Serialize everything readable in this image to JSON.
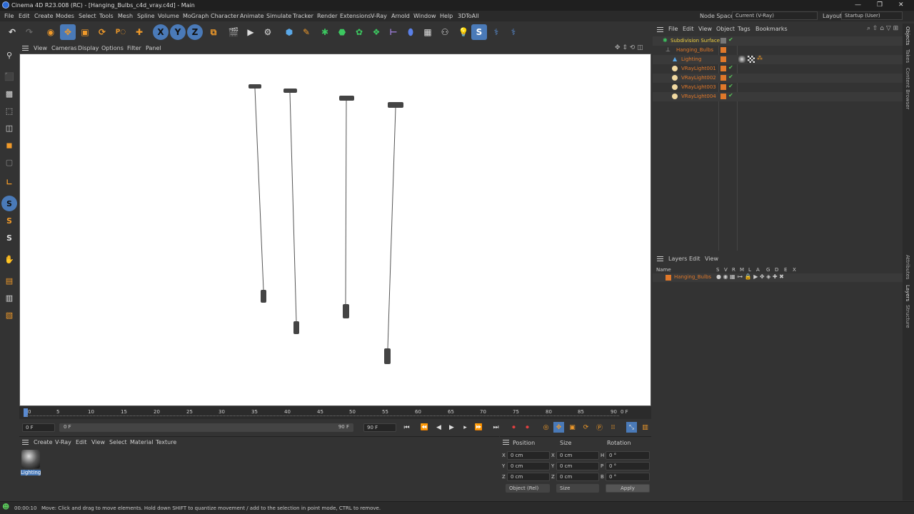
{
  "window": {
    "title": "Cinema 4D R23.008 (RC) - [Hanging_Bulbs_c4d_vray.c4d] - Main",
    "minimize": "—",
    "maximize": "❐",
    "close": "✕"
  },
  "menubar": [
    "File",
    "Edit",
    "Create",
    "Modes",
    "Select",
    "Tools",
    "Mesh",
    "Spline",
    "Volume",
    "MoGraph",
    "Character",
    "Animate",
    "Simulate",
    "Tracker",
    "Render",
    "Extensions",
    "V-Ray",
    "Arnold",
    "Window",
    "Help",
    "3DToAll"
  ],
  "node_space": {
    "label": "Node Space:",
    "value": "Current (V-Ray)"
  },
  "layout": {
    "label": "Layout:",
    "value": "Startup (User)"
  },
  "viewport_menu": [
    "View",
    "Cameras",
    "Display",
    "Options",
    "Filter",
    "Panel"
  ],
  "timeline": {
    "ticks": [
      "0",
      "5",
      "10",
      "15",
      "20",
      "25",
      "30",
      "35",
      "40",
      "45",
      "50",
      "55",
      "60",
      "65",
      "70",
      "75",
      "80",
      "85",
      "90"
    ],
    "current_frame": "0 F",
    "start_field": "0 F",
    "range_start": "0 F",
    "range_end": "90 F",
    "end_field": "90 F"
  },
  "material_menu": [
    "Create",
    "V-Ray",
    "Edit",
    "View",
    "Select",
    "Material",
    "Texture"
  ],
  "material": {
    "name": "Lighting"
  },
  "coords": {
    "headers": [
      "Position",
      "Size",
      "Rotation"
    ],
    "rows": [
      {
        "axis": "X",
        "pos": "0 cm",
        "saxis": "X",
        "size": "0 cm",
        "raxis": "H",
        "rot": "0 °"
      },
      {
        "axis": "Y",
        "pos": "0 cm",
        "saxis": "Y",
        "size": "0 cm",
        "raxis": "P",
        "rot": "0 °"
      },
      {
        "axis": "Z",
        "pos": "0 cm",
        "saxis": "Z",
        "size": "0 cm",
        "raxis": "B",
        "rot": "0 °"
      }
    ],
    "mode": "Object (Rel)",
    "size_mode": "Size",
    "apply": "Apply"
  },
  "status": {
    "time": "00:00:10",
    "message": "Move: Click and drag to move elements. Hold down SHIFT to quantize movement / add to the selection in point mode, CTRL to remove."
  },
  "object_menu": [
    "File",
    "Edit",
    "View",
    "Object",
    "Tags",
    "Bookmarks"
  ],
  "objects": [
    {
      "name": "Subdivision Surface",
      "color": "#f0d040"
    },
    {
      "name": "Hanging_Bulbs",
      "color": "#e0782a"
    },
    {
      "name": "Lighting",
      "color": "#e0782a"
    },
    {
      "name": "VRayLight001",
      "color": "#e0782a"
    },
    {
      "name": "VRayLight002",
      "color": "#e0782a"
    },
    {
      "name": "VRayLight003",
      "color": "#e0782a"
    },
    {
      "name": "VRayLight004",
      "color": "#e0782a"
    }
  ],
  "layer_menu": [
    "Layers",
    "Edit",
    "View"
  ],
  "layer_header": {
    "name": "Name",
    "cols": [
      "S",
      "V",
      "R",
      "M",
      "L",
      "A",
      "G",
      "D",
      "E",
      "X"
    ]
  },
  "layers": [
    {
      "name": "Hanging_Bulbs"
    }
  ],
  "side_tabs": [
    "Objects",
    "Takes",
    "Content Browser",
    "Attributes",
    "Layers",
    "Structure"
  ],
  "toolbar_axis": [
    "X",
    "Y",
    "Z"
  ]
}
